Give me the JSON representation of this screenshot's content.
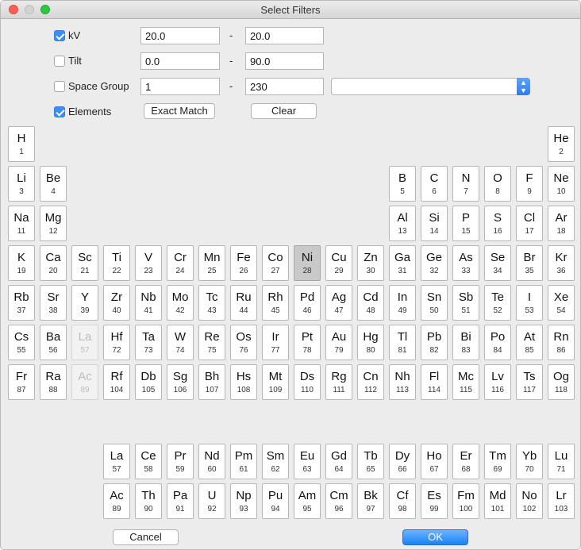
{
  "window": {
    "title": "Select Filters"
  },
  "filters": {
    "kv": {
      "label": "kV",
      "checked": true,
      "min": "20.0",
      "max": "20.0"
    },
    "tilt": {
      "label": "Tilt",
      "checked": false,
      "min": "0.0",
      "max": "90.0"
    },
    "space_group": {
      "label": "Space Group",
      "checked": false,
      "min": "1",
      "max": "230",
      "dropdown_value": ""
    },
    "elements": {
      "label": "Elements",
      "checked": true
    },
    "range_separator": "-",
    "exact_match_label": "Exact Match",
    "clear_label": "Clear"
  },
  "footer": {
    "cancel_label": "Cancel",
    "ok_label": "OK"
  },
  "colors": {
    "accent": "#1a82fb",
    "selected_element": "#c9c9c9"
  },
  "periodic_table": {
    "selected": [
      "Ni"
    ],
    "disabled": [
      "La",
      "Ac"
    ],
    "elements": [
      {
        "s": "H",
        "n": 1,
        "r": 0,
        "c": 0
      },
      {
        "s": "He",
        "n": 2,
        "r": 0,
        "c": 17
      },
      {
        "s": "Li",
        "n": 3,
        "r": 1,
        "c": 0
      },
      {
        "s": "Be",
        "n": 4,
        "r": 1,
        "c": 1
      },
      {
        "s": "B",
        "n": 5,
        "r": 1,
        "c": 12
      },
      {
        "s": "C",
        "n": 6,
        "r": 1,
        "c": 13
      },
      {
        "s": "N",
        "n": 7,
        "r": 1,
        "c": 14
      },
      {
        "s": "O",
        "n": 8,
        "r": 1,
        "c": 15
      },
      {
        "s": "F",
        "n": 9,
        "r": 1,
        "c": 16
      },
      {
        "s": "Ne",
        "n": 10,
        "r": 1,
        "c": 17
      },
      {
        "s": "Na",
        "n": 11,
        "r": 2,
        "c": 0
      },
      {
        "s": "Mg",
        "n": 12,
        "r": 2,
        "c": 1
      },
      {
        "s": "Al",
        "n": 13,
        "r": 2,
        "c": 12
      },
      {
        "s": "Si",
        "n": 14,
        "r": 2,
        "c": 13
      },
      {
        "s": "P",
        "n": 15,
        "r": 2,
        "c": 14
      },
      {
        "s": "S",
        "n": 16,
        "r": 2,
        "c": 15
      },
      {
        "s": "Cl",
        "n": 17,
        "r": 2,
        "c": 16
      },
      {
        "s": "Ar",
        "n": 18,
        "r": 2,
        "c": 17
      },
      {
        "s": "K",
        "n": 19,
        "r": 3,
        "c": 0
      },
      {
        "s": "Ca",
        "n": 20,
        "r": 3,
        "c": 1
      },
      {
        "s": "Sc",
        "n": 21,
        "r": 3,
        "c": 2
      },
      {
        "s": "Ti",
        "n": 22,
        "r": 3,
        "c": 3
      },
      {
        "s": "V",
        "n": 23,
        "r": 3,
        "c": 4
      },
      {
        "s": "Cr",
        "n": 24,
        "r": 3,
        "c": 5
      },
      {
        "s": "Mn",
        "n": 25,
        "r": 3,
        "c": 6
      },
      {
        "s": "Fe",
        "n": 26,
        "r": 3,
        "c": 7
      },
      {
        "s": "Co",
        "n": 27,
        "r": 3,
        "c": 8
      },
      {
        "s": "Ni",
        "n": 28,
        "r": 3,
        "c": 9
      },
      {
        "s": "Cu",
        "n": 29,
        "r": 3,
        "c": 10
      },
      {
        "s": "Zn",
        "n": 30,
        "r": 3,
        "c": 11
      },
      {
        "s": "Ga",
        "n": 31,
        "r": 3,
        "c": 12
      },
      {
        "s": "Ge",
        "n": 32,
        "r": 3,
        "c": 13
      },
      {
        "s": "As",
        "n": 33,
        "r": 3,
        "c": 14
      },
      {
        "s": "Se",
        "n": 34,
        "r": 3,
        "c": 15
      },
      {
        "s": "Br",
        "n": 35,
        "r": 3,
        "c": 16
      },
      {
        "s": "Kr",
        "n": 36,
        "r": 3,
        "c": 17
      },
      {
        "s": "Rb",
        "n": 37,
        "r": 4,
        "c": 0
      },
      {
        "s": "Sr",
        "n": 38,
        "r": 4,
        "c": 1
      },
      {
        "s": "Y",
        "n": 39,
        "r": 4,
        "c": 2
      },
      {
        "s": "Zr",
        "n": 40,
        "r": 4,
        "c": 3
      },
      {
        "s": "Nb",
        "n": 41,
        "r": 4,
        "c": 4
      },
      {
        "s": "Mo",
        "n": 42,
        "r": 4,
        "c": 5
      },
      {
        "s": "Tc",
        "n": 43,
        "r": 4,
        "c": 6
      },
      {
        "s": "Ru",
        "n": 44,
        "r": 4,
        "c": 7
      },
      {
        "s": "Rh",
        "n": 45,
        "r": 4,
        "c": 8
      },
      {
        "s": "Pd",
        "n": 46,
        "r": 4,
        "c": 9
      },
      {
        "s": "Ag",
        "n": 47,
        "r": 4,
        "c": 10
      },
      {
        "s": "Cd",
        "n": 48,
        "r": 4,
        "c": 11
      },
      {
        "s": "In",
        "n": 49,
        "r": 4,
        "c": 12
      },
      {
        "s": "Sn",
        "n": 50,
        "r": 4,
        "c": 13
      },
      {
        "s": "Sb",
        "n": 51,
        "r": 4,
        "c": 14
      },
      {
        "s": "Te",
        "n": 52,
        "r": 4,
        "c": 15
      },
      {
        "s": "I",
        "n": 53,
        "r": 4,
        "c": 16
      },
      {
        "s": "Xe",
        "n": 54,
        "r": 4,
        "c": 17
      },
      {
        "s": "Cs",
        "n": 55,
        "r": 5,
        "c": 0
      },
      {
        "s": "Ba",
        "n": 56,
        "r": 5,
        "c": 1
      },
      {
        "s": "La",
        "n": 57,
        "r": 5,
        "c": 2
      },
      {
        "s": "Hf",
        "n": 72,
        "r": 5,
        "c": 3
      },
      {
        "s": "Ta",
        "n": 73,
        "r": 5,
        "c": 4
      },
      {
        "s": "W",
        "n": 74,
        "r": 5,
        "c": 5
      },
      {
        "s": "Re",
        "n": 75,
        "r": 5,
        "c": 6
      },
      {
        "s": "Os",
        "n": 76,
        "r": 5,
        "c": 7
      },
      {
        "s": "Ir",
        "n": 77,
        "r": 5,
        "c": 8
      },
      {
        "s": "Pt",
        "n": 78,
        "r": 5,
        "c": 9
      },
      {
        "s": "Au",
        "n": 79,
        "r": 5,
        "c": 10
      },
      {
        "s": "Hg",
        "n": 80,
        "r": 5,
        "c": 11
      },
      {
        "s": "Tl",
        "n": 81,
        "r": 5,
        "c": 12
      },
      {
        "s": "Pb",
        "n": 82,
        "r": 5,
        "c": 13
      },
      {
        "s": "Bi",
        "n": 83,
        "r": 5,
        "c": 14
      },
      {
        "s": "Po",
        "n": 84,
        "r": 5,
        "c": 15
      },
      {
        "s": "At",
        "n": 85,
        "r": 5,
        "c": 16
      },
      {
        "s": "Rn",
        "n": 86,
        "r": 5,
        "c": 17
      },
      {
        "s": "Fr",
        "n": 87,
        "r": 6,
        "c": 0
      },
      {
        "s": "Ra",
        "n": 88,
        "r": 6,
        "c": 1
      },
      {
        "s": "Ac",
        "n": 89,
        "r": 6,
        "c": 2
      },
      {
        "s": "Rf",
        "n": 104,
        "r": 6,
        "c": 3
      },
      {
        "s": "Db",
        "n": 105,
        "r": 6,
        "c": 4
      },
      {
        "s": "Sg",
        "n": 106,
        "r": 6,
        "c": 5
      },
      {
        "s": "Bh",
        "n": 107,
        "r": 6,
        "c": 6
      },
      {
        "s": "Hs",
        "n": 108,
        "r": 6,
        "c": 7
      },
      {
        "s": "Mt",
        "n": 109,
        "r": 6,
        "c": 8
      },
      {
        "s": "Ds",
        "n": 110,
        "r": 6,
        "c": 9
      },
      {
        "s": "Rg",
        "n": 111,
        "r": 6,
        "c": 10
      },
      {
        "s": "Cn",
        "n": 112,
        "r": 6,
        "c": 11
      },
      {
        "s": "Nh",
        "n": 113,
        "r": 6,
        "c": 12
      },
      {
        "s": "Fl",
        "n": 114,
        "r": 6,
        "c": 13
      },
      {
        "s": "Mc",
        "n": 115,
        "r": 6,
        "c": 14
      },
      {
        "s": "Lv",
        "n": 116,
        "r": 6,
        "c": 15
      },
      {
        "s": "Ts",
        "n": 117,
        "r": 6,
        "c": 16
      },
      {
        "s": "Og",
        "n": 118,
        "r": 6,
        "c": 17
      },
      {
        "s": "La",
        "n": 57,
        "r": 8,
        "c": 3
      },
      {
        "s": "Ce",
        "n": 58,
        "r": 8,
        "c": 4
      },
      {
        "s": "Pr",
        "n": 59,
        "r": 8,
        "c": 5
      },
      {
        "s": "Nd",
        "n": 60,
        "r": 8,
        "c": 6
      },
      {
        "s": "Pm",
        "n": 61,
        "r": 8,
        "c": 7
      },
      {
        "s": "Sm",
        "n": 62,
        "r": 8,
        "c": 8
      },
      {
        "s": "Eu",
        "n": 63,
        "r": 8,
        "c": 9
      },
      {
        "s": "Gd",
        "n": 64,
        "r": 8,
        "c": 10
      },
      {
        "s": "Tb",
        "n": 65,
        "r": 8,
        "c": 11
      },
      {
        "s": "Dy",
        "n": 66,
        "r": 8,
        "c": 12
      },
      {
        "s": "Ho",
        "n": 67,
        "r": 8,
        "c": 13
      },
      {
        "s": "Er",
        "n": 68,
        "r": 8,
        "c": 14
      },
      {
        "s": "Tm",
        "n": 69,
        "r": 8,
        "c": 15
      },
      {
        "s": "Yb",
        "n": 70,
        "r": 8,
        "c": 16
      },
      {
        "s": "Lu",
        "n": 71,
        "r": 8,
        "c": 17
      },
      {
        "s": "Ac",
        "n": 89,
        "r": 9,
        "c": 3
      },
      {
        "s": "Th",
        "n": 90,
        "r": 9,
        "c": 4
      },
      {
        "s": "Pa",
        "n": 91,
        "r": 9,
        "c": 5
      },
      {
        "s": "U",
        "n": 92,
        "r": 9,
        "c": 6
      },
      {
        "s": "Np",
        "n": 93,
        "r": 9,
        "c": 7
      },
      {
        "s": "Pu",
        "n": 94,
        "r": 9,
        "c": 8
      },
      {
        "s": "Am",
        "n": 95,
        "r": 9,
        "c": 9
      },
      {
        "s": "Cm",
        "n": 96,
        "r": 9,
        "c": 10
      },
      {
        "s": "Bk",
        "n": 97,
        "r": 9,
        "c": 11
      },
      {
        "s": "Cf",
        "n": 98,
        "r": 9,
        "c": 12
      },
      {
        "s": "Es",
        "n": 99,
        "r": 9,
        "c": 13
      },
      {
        "s": "Fm",
        "n": 100,
        "r": 9,
        "c": 14
      },
      {
        "s": "Md",
        "n": 101,
        "r": 9,
        "c": 15
      },
      {
        "s": "No",
        "n": 102,
        "r": 9,
        "c": 16
      },
      {
        "s": "Lr",
        "n": 103,
        "r": 9,
        "c": 17
      }
    ]
  }
}
